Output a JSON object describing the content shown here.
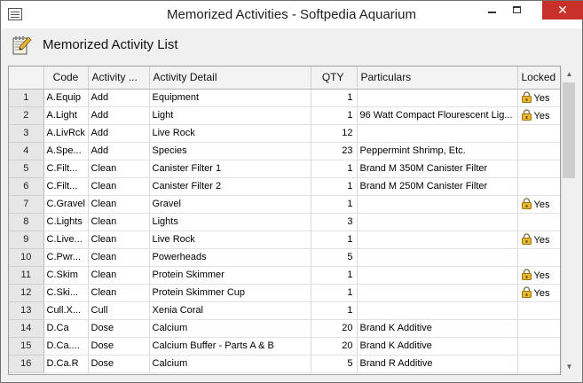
{
  "window": {
    "title": "Memorized Activities  -  Softpedia Aquarium",
    "minimize_icon": "minimize-icon",
    "maximize_icon": "maximize-icon",
    "close_icon": "close-icon",
    "close_glyph": "✕"
  },
  "header": {
    "icon": "notepad-pencil-icon",
    "title": "Memorized Activity List"
  },
  "grid": {
    "columns": {
      "num": "",
      "code": "Code",
      "activity": "Activity ...",
      "detail": "Activity Detail",
      "qty": "QTY",
      "particulars": "Particulars",
      "locked": "Locked"
    },
    "rows": [
      {
        "num": "1",
        "code": "A.Equip",
        "activity": "Add",
        "detail": "Equipment",
        "qty": "1",
        "particulars": "",
        "locked": "Yes"
      },
      {
        "num": "2",
        "code": "A.Light",
        "activity": "Add",
        "detail": "Light",
        "qty": "1",
        "particulars": "96 Watt Compact Flourescent Lig...",
        "locked": "Yes"
      },
      {
        "num": "3",
        "code": "A.LivRck",
        "activity": "Add",
        "detail": "Live Rock",
        "qty": "12",
        "particulars": "",
        "locked": ""
      },
      {
        "num": "4",
        "code": "A.Spe...",
        "activity": "Add",
        "detail": "Species",
        "qty": "23",
        "particulars": "Peppermint Shrimp, Etc.",
        "locked": ""
      },
      {
        "num": "5",
        "code": "C.Filt...",
        "activity": "Clean",
        "detail": "Canister Filter 1",
        "qty": "1",
        "particulars": "Brand M 350M Canister Filter",
        "locked": ""
      },
      {
        "num": "6",
        "code": "C.Filt...",
        "activity": "Clean",
        "detail": "Canister Filter 2",
        "qty": "1",
        "particulars": "Brand M 250M Canister Filter",
        "locked": ""
      },
      {
        "num": "7",
        "code": "C.Gravel",
        "activity": "Clean",
        "detail": "Gravel",
        "qty": "1",
        "particulars": "",
        "locked": "Yes"
      },
      {
        "num": "8",
        "code": "C.Lights",
        "activity": "Clean",
        "detail": "Lights",
        "qty": "3",
        "particulars": "",
        "locked": ""
      },
      {
        "num": "9",
        "code": "C.Live...",
        "activity": "Clean",
        "detail": "Live Rock",
        "qty": "1",
        "particulars": "",
        "locked": "Yes"
      },
      {
        "num": "10",
        "code": "C.Pwr...",
        "activity": "Clean",
        "detail": "Powerheads",
        "qty": "5",
        "particulars": "",
        "locked": ""
      },
      {
        "num": "11",
        "code": "C.Skim",
        "activity": "Clean",
        "detail": "Protein Skimmer",
        "qty": "1",
        "particulars": "",
        "locked": "Yes"
      },
      {
        "num": "12",
        "code": "C.Ski...",
        "activity": "Clean",
        "detail": "Protein Skimmer Cup",
        "qty": "1",
        "particulars": "",
        "locked": "Yes"
      },
      {
        "num": "13",
        "code": "Cull.X...",
        "activity": "Cull",
        "detail": "Xenia Coral",
        "qty": "1",
        "particulars": "",
        "locked": ""
      },
      {
        "num": "14",
        "code": "D.Ca",
        "activity": "Dose",
        "detail": "Calcium",
        "qty": "20",
        "particulars": "Brand K Additive",
        "locked": ""
      },
      {
        "num": "15",
        "code": "D.Ca....",
        "activity": "Dose",
        "detail": "Calcium Buffer - Parts A & B",
        "qty": "20",
        "particulars": "Brand K Additive",
        "locked": ""
      },
      {
        "num": "16",
        "code": "D.Ca.R",
        "activity": "Dose",
        "detail": "Calcium",
        "qty": "5",
        "particulars": "Brand R Additive",
        "locked": ""
      }
    ],
    "lock_icon": "padlock-icon"
  },
  "scrollbar": {
    "up_icon": "scroll-up-arrow-icon",
    "down_icon": "scroll-down-arrow-icon",
    "up_glyph": "▲",
    "down_glyph": "▼"
  }
}
